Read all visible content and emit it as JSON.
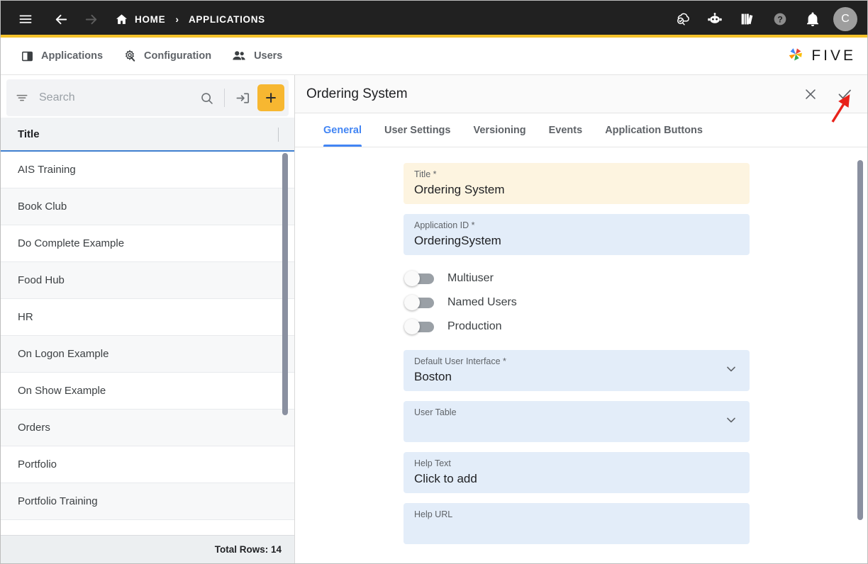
{
  "topbar": {
    "menu_icon": "hamburger-menu-icon",
    "back_icon": "arrow-back-icon",
    "forward_icon": "arrow-forward-icon",
    "home_icon": "home-icon",
    "home_label": "HOME",
    "separator": "›",
    "current_label": "APPLICATIONS",
    "right_icons": [
      {
        "name": "cloud-check-search-icon",
        "label": "Deploy"
      },
      {
        "name": "robot-assistant-icon",
        "label": "AI Assistant"
      },
      {
        "name": "books-library-icon",
        "label": "Documentation"
      },
      {
        "name": "help-question-icon",
        "label": "Help"
      },
      {
        "name": "notification-bell-icon",
        "label": "Notifications"
      }
    ],
    "avatar_initial": "C",
    "accent_color": "#F5C22B",
    "background_color": "#212121"
  },
  "modulebar": {
    "items": [
      {
        "label": "Applications",
        "icon": "applications-panel-icon"
      },
      {
        "label": "Configuration",
        "icon": "gear-wrench-icon"
      },
      {
        "label": "Users",
        "icon": "users-group-icon"
      }
    ],
    "logo_text": "FIVE",
    "logo_icon": "five-pinwheel-logo-icon"
  },
  "sidebar": {
    "search": {
      "placeholder": "Search",
      "value": "",
      "filter_icon": "filter-lines-icon",
      "search_icon": "magnifier-icon",
      "import_icon": "import-arrow-icon",
      "add_icon": "plus-icon",
      "add_color": "#F7B731"
    },
    "column_header": "Title",
    "rows": [
      {
        "title": "AIS Training"
      },
      {
        "title": "Book Club"
      },
      {
        "title": "Do Complete Example"
      },
      {
        "title": "Food Hub"
      },
      {
        "title": "HR"
      },
      {
        "title": "On Logon Example"
      },
      {
        "title": "On Show Example"
      },
      {
        "title": "Orders"
      },
      {
        "title": "Portfolio"
      },
      {
        "title": "Portfolio Training"
      }
    ],
    "total_rows_label": "Total Rows: 14"
  },
  "main": {
    "title": "Ordering System",
    "close_icon": "close-x-icon",
    "save_icon": "checkmark-save-icon",
    "tabs": [
      {
        "label": "General",
        "active": true
      },
      {
        "label": "User Settings",
        "active": false
      },
      {
        "label": "Versioning",
        "active": false
      },
      {
        "label": "Events",
        "active": false
      },
      {
        "label": "Application Buttons",
        "active": false
      }
    ],
    "fields": {
      "title": {
        "label": "Title *",
        "value": "Ordering System",
        "style": "yellow"
      },
      "application_id": {
        "label": "Application ID *",
        "value": "OrderingSystem",
        "style": "blue"
      },
      "default_user_interface": {
        "label": "Default User Interface *",
        "value": "Boston",
        "style": "blue"
      },
      "user_table": {
        "label": "User Table",
        "value": "",
        "style": "blue"
      },
      "help_text": {
        "label": "Help Text",
        "value": "Click to add",
        "style": "blue"
      },
      "help_url": {
        "label": "Help URL",
        "value": "",
        "style": "blue"
      }
    },
    "toggles": [
      {
        "label": "Multiuser",
        "on": false
      },
      {
        "label": "Named Users",
        "on": false
      },
      {
        "label": "Production",
        "on": false
      }
    ]
  },
  "annotation": {
    "arrow_color": "#E8221A",
    "points_at": "save-checkmark-button"
  }
}
